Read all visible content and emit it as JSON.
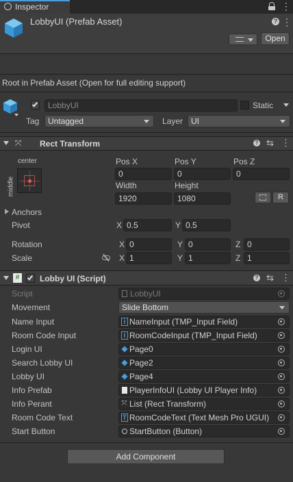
{
  "tab": {
    "label": "Inspector"
  },
  "asset": {
    "title": "LobbyUI (Prefab Asset)",
    "open_label": "Open"
  },
  "notice": "Root in Prefab Asset (Open for full editing support)",
  "gameobject": {
    "name": "LobbyUI",
    "static_label": "Static",
    "tag_label": "Tag",
    "tag_value": "Untagged",
    "layer_label": "Layer",
    "layer_value": "UI"
  },
  "rect_transform": {
    "title": "Rect Transform",
    "anchor_h": "center",
    "anchor_v": "middle",
    "posx_label": "Pos X",
    "posx": "0",
    "posy_label": "Pos Y",
    "posy": "0",
    "posz_label": "Pos Z",
    "posz": "0",
    "width_label": "Width",
    "width": "1920",
    "height_label": "Height",
    "height": "1080",
    "r_label": "R",
    "anchors_label": "Anchors",
    "pivot_label": "Pivot",
    "pivot_x": "0.5",
    "pivot_y": "0.5",
    "rotation_label": "Rotation",
    "rot_x": "0",
    "rot_y": "0",
    "rot_z": "0",
    "scale_label": "Scale",
    "scale_x": "1",
    "scale_y": "1",
    "scale_z": "1",
    "x": "X",
    "y": "Y",
    "z": "Z"
  },
  "script": {
    "title": "Lobby UI (Script)",
    "rows": [
      {
        "label": "Script",
        "value": "LobbyUI"
      },
      {
        "label": "Movement",
        "value": "Slide Bottom"
      },
      {
        "label": "Name Input",
        "value": "NameInput (TMP_Input Field)"
      },
      {
        "label": "Room Code Input",
        "value": "RoomCodeInput (TMP_Input Field)"
      },
      {
        "label": "Login UI",
        "value": "Page0"
      },
      {
        "label": "Search Lobby UI",
        "value": "Page2"
      },
      {
        "label": "Lobby UI",
        "value": "Page4"
      },
      {
        "label": "Info Prefab",
        "value": "PlayerInfoUI (Lobby UI Player Info)"
      },
      {
        "label": "Info Perant",
        "value": "List (Rect Transform)"
      },
      {
        "label": "Room Code Text",
        "value": "RoomCodeText (Text Mesh Pro UGUI)"
      },
      {
        "label": "Start Button",
        "value": "StartButton (Button)"
      }
    ]
  },
  "add_component": "Add Component",
  "colors": {
    "accent": "#4a9eda",
    "panel": "#383838",
    "header": "#3e3e3e",
    "field": "#2a2a2a"
  },
  "icons": [
    "inspector-icon",
    "lock-icon",
    "kebab-icon",
    "prefab-cube-icon",
    "help-icon",
    "settings-icon",
    "rect-transform-icon",
    "script-icon",
    "text-field-icon",
    "object-picker-icon"
  ]
}
